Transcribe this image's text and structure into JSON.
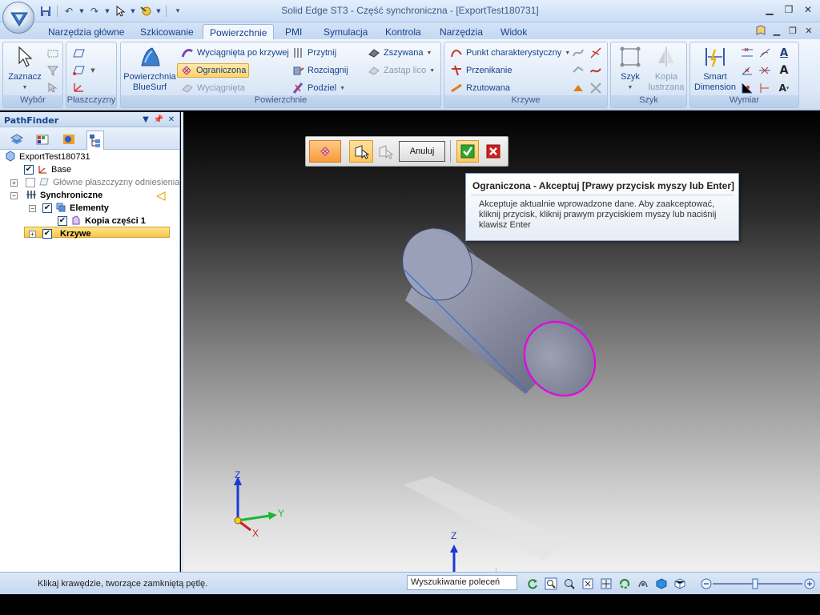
{
  "window": {
    "title": "Solid Edge ST3 - Część synchroniczna - [ExportTest180731]"
  },
  "tabs": [
    {
      "label": "Narzędzia główne",
      "active": false
    },
    {
      "label": "Szkicowanie",
      "active": false
    },
    {
      "label": "Powierzchnie",
      "active": true
    },
    {
      "label": "PMI",
      "active": false
    },
    {
      "label": "Symulacja",
      "active": false
    },
    {
      "label": "Kontrola",
      "active": false
    },
    {
      "label": "Narzędzia",
      "active": false
    },
    {
      "label": "Widok",
      "active": false
    }
  ],
  "ribbon": {
    "groups": {
      "wybor": "Wybór",
      "plaszczyzny": "Płaszczyzny",
      "powierzchnie": "Powierzchnie",
      "krzywe": "Krzywe",
      "szyk": "Szyk",
      "wymiar": "Wymiar"
    },
    "zaznacz": "Zaznacz",
    "bluesurf": "Powierzchnia BlueSurf",
    "wyciagnieta_po_krzywej": "Wyciągnięta po krzywej",
    "ograniczona": "Ograniczona",
    "wyciagnieta": "Wyciągnięta",
    "przytnij": "Przytnij",
    "rozciagnij": "Rozciągnij",
    "podziel": "Podziel",
    "zszywana": "Zszywana",
    "zastap_lico": "Zastąp lico",
    "punkt_charakterystyczny": "Punkt charakterystyczny",
    "przenikanie": "Przenikanie",
    "rzutowana": "Rzutowana",
    "szyk": "Szyk",
    "kopia_lustrzana": "Kopia lustrzana",
    "smart_dimension": "Smart Dimension"
  },
  "pathfinder": {
    "title": "PathFinder",
    "tree": {
      "root": "ExportTest180731",
      "base": "Base",
      "glowne": "Główne płaszczyzny odniesienia",
      "synchroniczne": "Synchroniczne",
      "elementy": "Elementy",
      "kopia": "Kopia części 1",
      "krzywe": "Krzywe"
    }
  },
  "command_bar": {
    "cancel": "Anuluj"
  },
  "tooltip": {
    "title": "Ograniczona - Akceptuj [Prawy przycisk myszy lub Enter]",
    "body": "Akceptuje aktualnie wprowadzone dane.  Aby zaakceptować, kliknij przycisk, kliknij prawym przyciskiem myszy lub naciśnij klawisz Enter"
  },
  "triad": {
    "z": "Z",
    "y": "Y",
    "x": "X"
  },
  "statusbar": {
    "prompt": "Klikaj krawędzie, tworzące zamkniętą pętlę.",
    "search_placeholder": "Wyszukiwanie poleceń"
  },
  "colors": {
    "selection_edge": "#e600e6",
    "ribbon_highlight": "#ffd36b",
    "accept": "#2fa52f",
    "cancel": "#d21f1f"
  }
}
